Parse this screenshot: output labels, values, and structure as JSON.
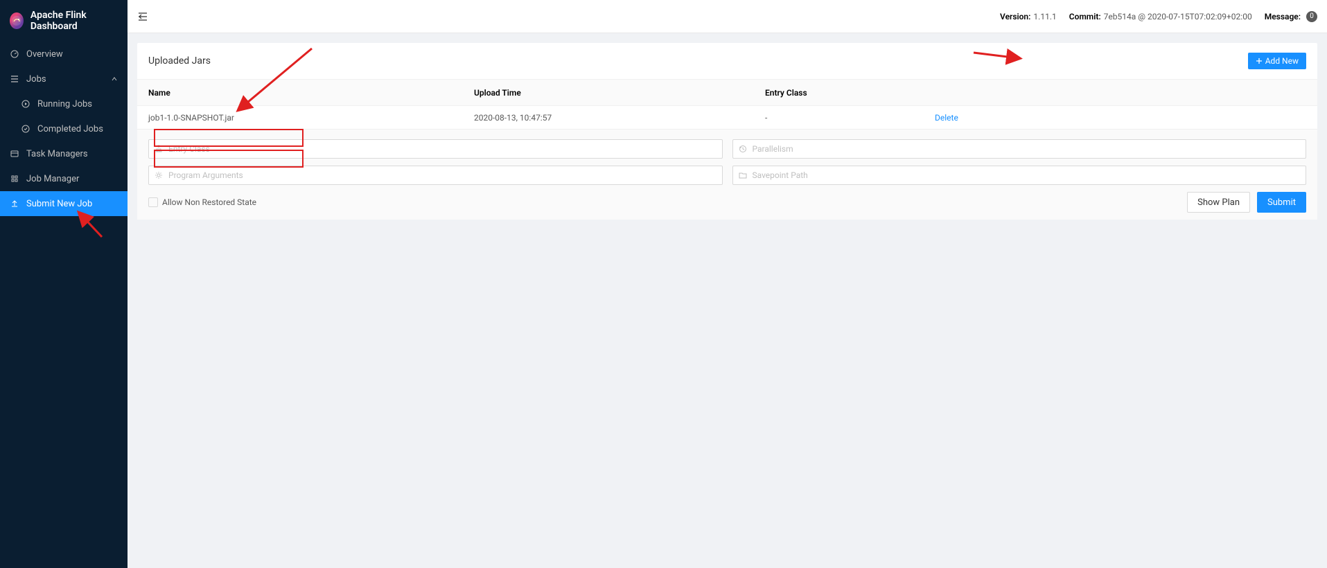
{
  "app_title": "Apache Flink Dashboard",
  "sidebar": {
    "items": [
      {
        "label": "Overview"
      },
      {
        "label": "Jobs"
      },
      {
        "label": "Running Jobs"
      },
      {
        "label": "Completed Jobs"
      },
      {
        "label": "Task Managers"
      },
      {
        "label": "Job Manager"
      },
      {
        "label": "Submit New Job"
      }
    ]
  },
  "topbar": {
    "version_label": "Version:",
    "version": "1.11.1",
    "commit_label": "Commit:",
    "commit": "7eb514a @ 2020-07-15T07:02:09+02:00",
    "message_label": "Message:",
    "message_count": "0"
  },
  "card": {
    "title": "Uploaded Jars",
    "add_new": "Add New",
    "columns": {
      "name": "Name",
      "upload_time": "Upload Time",
      "entry_class": "Entry Class"
    },
    "row": {
      "name": "job1-1.0-SNAPSHOT.jar",
      "upload_time": "2020-08-13, 10:47:57",
      "entry_class": "-",
      "delete": "Delete"
    },
    "form": {
      "entry_class_ph": "Entry Class",
      "parallelism_ph": "Parallelism",
      "program_args_ph": "Program Arguments",
      "savepoint_ph": "Savepoint Path",
      "allow_non_restored": "Allow Non Restored State",
      "show_plan": "Show Plan",
      "submit": "Submit"
    }
  }
}
